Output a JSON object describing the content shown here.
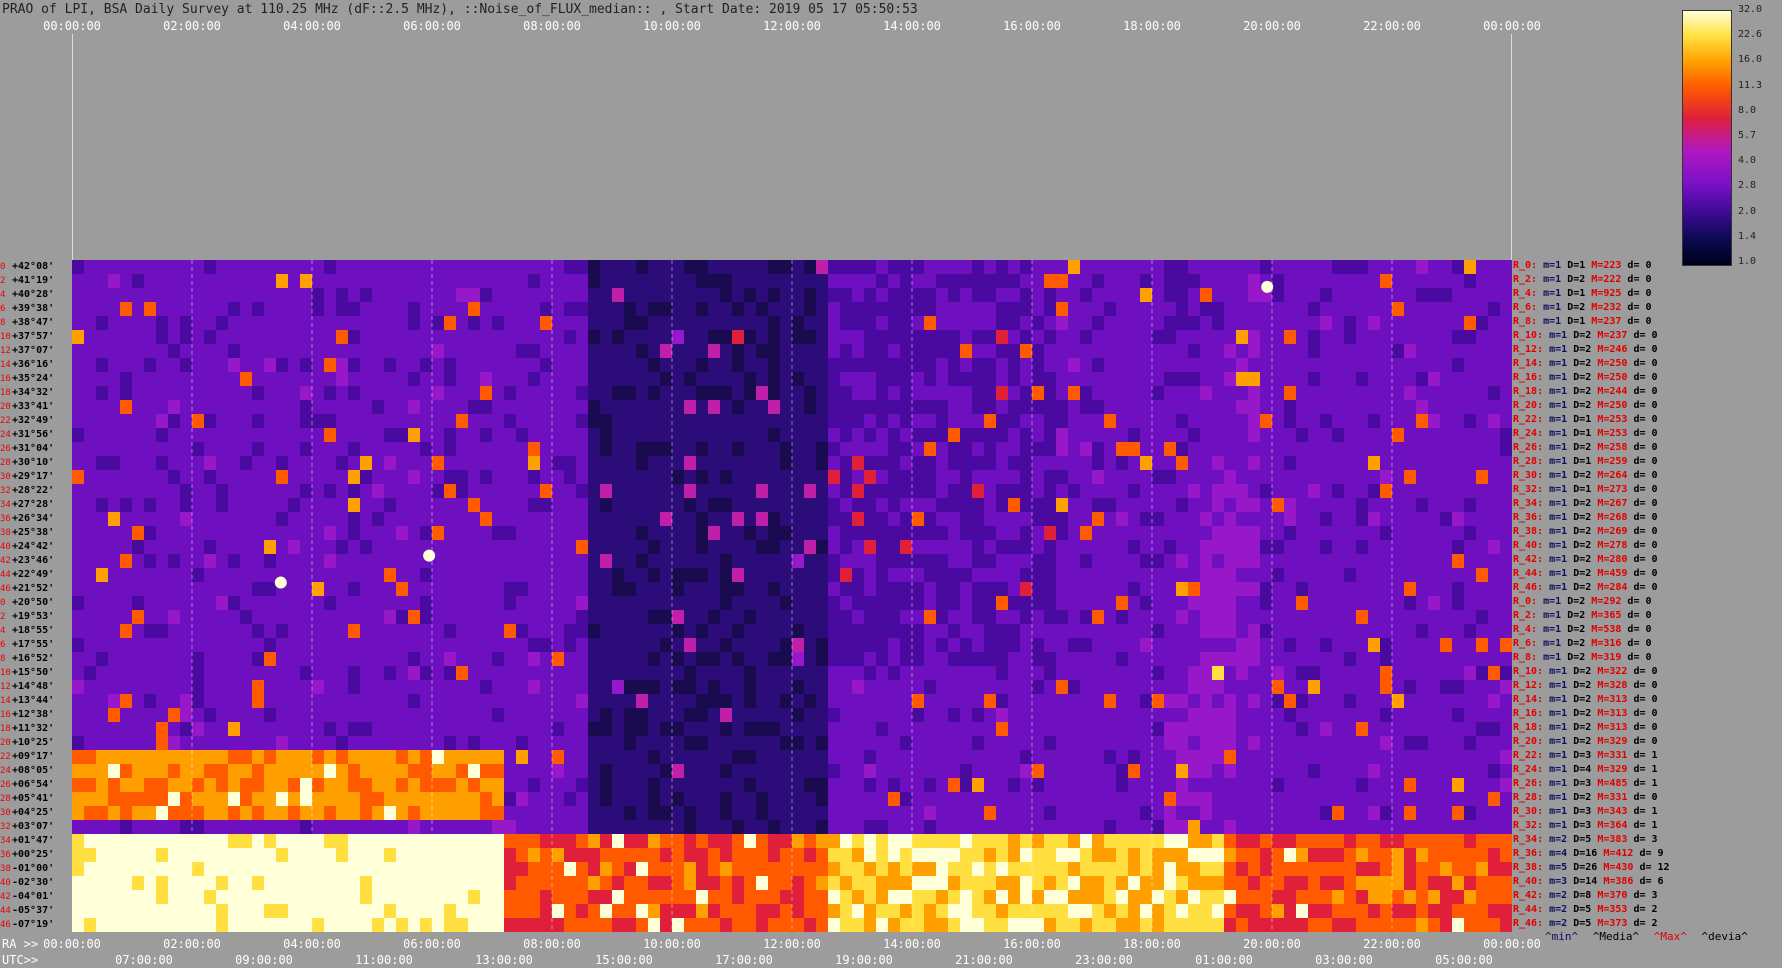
{
  "title": "PRAO of LPI, BSA Daily Survey at 110.25 MHz (dF::2.5 MHz), ::Noise_of_FLUX_median:: , Start Date: 2019 05 17 05:50:53",
  "top_axis": [
    "00:00:00",
    "02:00:00",
    "04:00:00",
    "06:00:00",
    "08:00:00",
    "10:00:00",
    "12:00:00",
    "14:00:00",
    "16:00:00",
    "18:00:00",
    "20:00:00",
    "22:00:00",
    "00:00:00"
  ],
  "ra_label": "RA >>",
  "utc_label": "UTC>>",
  "ra_axis": [
    "00:00:00",
    "02:00:00",
    "04:00:00",
    "06:00:00",
    "08:00:00",
    "10:00:00",
    "12:00:00",
    "14:00:00",
    "16:00:00",
    "18:00:00",
    "20:00:00",
    "22:00:00",
    "00:00:00"
  ],
  "utc_axis": [
    "07:00:00",
    "09:00:00",
    "11:00:00",
    "13:00:00",
    "15:00:00",
    "17:00:00",
    "19:00:00",
    "21:00:00",
    "23:00:00",
    "01:00:00",
    "03:00:00",
    "05:00:00"
  ],
  "colorbar": {
    "ticks": [
      "32.0",
      "22.6",
      "16.0",
      "11.3",
      "8.0",
      "5.7",
      "4.0",
      "2.8",
      "2.0",
      "1.4",
      "1.0"
    ],
    "colors": [
      "#000018",
      "#3a0a90",
      "#b018c0",
      "#e0203a",
      "#ff5a00",
      "#ffa000",
      "#ffe040",
      "#ffffd8"
    ]
  },
  "bottom_legend": {
    "min": "^min^",
    "median": "^Media^",
    "max": "^Max^",
    "dev": "^devia^"
  },
  "chart_data": {
    "type": "heatmap",
    "title": "PRAO of LPI, BSA Daily Survey at 110.25 MHz (dF::2.5 MHz), ::Noise_of_FLUX_median:: , Start Date: 2019 05 17 05:50:53",
    "x_axis_ra": [
      "00:00:00",
      "02:00:00",
      "04:00:00",
      "06:00:00",
      "08:00:00",
      "10:00:00",
      "12:00:00",
      "14:00:00",
      "16:00:00",
      "18:00:00",
      "20:00:00",
      "22:00:00",
      "00:00:00"
    ],
    "x_axis_utc": [
      "07:00:00",
      "09:00:00",
      "11:00:00",
      "13:00:00",
      "15:00:00",
      "17:00:00",
      "19:00:00",
      "21:00:00",
      "23:00:00",
      "01:00:00",
      "03:00:00",
      "05:00:00"
    ],
    "colorbar_range": [
      1.0,
      32.0
    ],
    "rows": [
      {
        "idx": "0",
        "dec": "+42°08'",
        "r": "R_0:",
        "m": "1",
        "D": "1",
        "M": "223",
        "d": "0"
      },
      {
        "idx": "2",
        "dec": "+41°19'",
        "r": "R_2:",
        "m": "1",
        "D": "2",
        "M": "222",
        "d": "0"
      },
      {
        "idx": "4",
        "dec": "+40°28'",
        "r": "R_4:",
        "m": "1",
        "D": "1",
        "M": "925",
        "d": "0"
      },
      {
        "idx": "6",
        "dec": "+39°38'",
        "r": "R_6:",
        "m": "1",
        "D": "2",
        "M": "232",
        "d": "0"
      },
      {
        "idx": "8",
        "dec": "+38°47'",
        "r": "R_8:",
        "m": "1",
        "D": "1",
        "M": "237",
        "d": "0"
      },
      {
        "idx": "10",
        "dec": "+37°57'",
        "r": "R_10:",
        "m": "1",
        "D": "2",
        "M": "237",
        "d": "0"
      },
      {
        "idx": "12",
        "dec": "+37°07'",
        "r": "R_12:",
        "m": "1",
        "D": "2",
        "M": "246",
        "d": "0"
      },
      {
        "idx": "14",
        "dec": "+36°16'",
        "r": "R_14:",
        "m": "1",
        "D": "2",
        "M": "250",
        "d": "0"
      },
      {
        "idx": "16",
        "dec": "+35°24'",
        "r": "R_16:",
        "m": "1",
        "D": "2",
        "M": "250",
        "d": "0"
      },
      {
        "idx": "18",
        "dec": "+34°32'",
        "r": "R_18:",
        "m": "1",
        "D": "2",
        "M": "244",
        "d": "0"
      },
      {
        "idx": "20",
        "dec": "+33°41'",
        "r": "R_20:",
        "m": "1",
        "D": "2",
        "M": "250",
        "d": "0"
      },
      {
        "idx": "22",
        "dec": "+32°49'",
        "r": "R_22:",
        "m": "1",
        "D": "1",
        "M": "253",
        "d": "0"
      },
      {
        "idx": "24",
        "dec": "+31°56'",
        "r": "R_24:",
        "m": "1",
        "D": "1",
        "M": "253",
        "d": "0"
      },
      {
        "idx": "26",
        "dec": "+31°04'",
        "r": "R_26:",
        "m": "1",
        "D": "2",
        "M": "258",
        "d": "0"
      },
      {
        "idx": "28",
        "dec": "+30°10'",
        "r": "R_28:",
        "m": "1",
        "D": "1",
        "M": "259",
        "d": "0"
      },
      {
        "idx": "30",
        "dec": "+29°17'",
        "r": "R_30:",
        "m": "1",
        "D": "2",
        "M": "264",
        "d": "0"
      },
      {
        "idx": "32",
        "dec": "+28°22'",
        "r": "R_32:",
        "m": "1",
        "D": "1",
        "M": "273",
        "d": "0"
      },
      {
        "idx": "34",
        "dec": "+27°28'",
        "r": "R_34:",
        "m": "1",
        "D": "2",
        "M": "267",
        "d": "0"
      },
      {
        "idx": "36",
        "dec": "+26°34'",
        "r": "R_36:",
        "m": "1",
        "D": "2",
        "M": "268",
        "d": "0"
      },
      {
        "idx": "38",
        "dec": "+25°38'",
        "r": "R_38:",
        "m": "1",
        "D": "2",
        "M": "269",
        "d": "0"
      },
      {
        "idx": "40",
        "dec": "+24°42'",
        "r": "R_40:",
        "m": "1",
        "D": "2",
        "M": "278",
        "d": "0"
      },
      {
        "idx": "42",
        "dec": "+23°46'",
        "r": "R_42:",
        "m": "1",
        "D": "2",
        "M": "280",
        "d": "0"
      },
      {
        "idx": "44",
        "dec": "+22°49'",
        "r": "R_44:",
        "m": "1",
        "D": "2",
        "M": "459",
        "d": "0"
      },
      {
        "idx": "46",
        "dec": "+21°52'",
        "r": "R_46:",
        "m": "1",
        "D": "2",
        "M": "284",
        "d": "0"
      },
      {
        "idx": "0",
        "dec": "+20°50'",
        "r": "R_0:",
        "m": "1",
        "D": "2",
        "M": "292",
        "d": "0"
      },
      {
        "idx": "2",
        "dec": "+19°53'",
        "r": "R_2:",
        "m": "1",
        "D": "2",
        "M": "365",
        "d": "0"
      },
      {
        "idx": "4",
        "dec": "+18°55'",
        "r": "R_4:",
        "m": "1",
        "D": "2",
        "M": "538",
        "d": "0"
      },
      {
        "idx": "6",
        "dec": "+17°55'",
        "r": "R_6:",
        "m": "1",
        "D": "2",
        "M": "316",
        "d": "0"
      },
      {
        "idx": "8",
        "dec": "+16°52'",
        "r": "R_8:",
        "m": "1",
        "D": "2",
        "M": "319",
        "d": "0"
      },
      {
        "idx": "10",
        "dec": "+15°50'",
        "r": "R_10:",
        "m": "1",
        "D": "2",
        "M": "322",
        "d": "0"
      },
      {
        "idx": "12",
        "dec": "+14°48'",
        "r": "R_12:",
        "m": "1",
        "D": "2",
        "M": "328",
        "d": "0"
      },
      {
        "idx": "14",
        "dec": "+13°44'",
        "r": "R_14:",
        "m": "1",
        "D": "2",
        "M": "313",
        "d": "0"
      },
      {
        "idx": "16",
        "dec": "+12°38'",
        "r": "R_16:",
        "m": "1",
        "D": "2",
        "M": "313",
        "d": "0"
      },
      {
        "idx": "18",
        "dec": "+11°32'",
        "r": "R_18:",
        "m": "1",
        "D": "2",
        "M": "313",
        "d": "0"
      },
      {
        "idx": "20",
        "dec": "+10°25'",
        "r": "R_20:",
        "m": "1",
        "D": "2",
        "M": "329",
        "d": "0"
      },
      {
        "idx": "22",
        "dec": "+09°17'",
        "r": "R_22:",
        "m": "1",
        "D": "3",
        "M": "331",
        "d": "1"
      },
      {
        "idx": "24",
        "dec": "+08°05'",
        "r": "R_24:",
        "m": "1",
        "D": "4",
        "M": "329",
        "d": "1"
      },
      {
        "idx": "26",
        "dec": "+06°54'",
        "r": "R_26:",
        "m": "1",
        "D": "3",
        "M": "485",
        "d": "1"
      },
      {
        "idx": "28",
        "dec": "+05°41'",
        "r": "R_28:",
        "m": "1",
        "D": "2",
        "M": "331",
        "d": "0"
      },
      {
        "idx": "30",
        "dec": "+04°25'",
        "r": "R_30:",
        "m": "1",
        "D": "3",
        "M": "343",
        "d": "1"
      },
      {
        "idx": "32",
        "dec": "+03°07'",
        "r": "R_32:",
        "m": "1",
        "D": "3",
        "M": "364",
        "d": "1"
      },
      {
        "idx": "34",
        "dec": "+01°47'",
        "r": "R_34:",
        "m": "2",
        "D": "5",
        "M": "383",
        "d": "3"
      },
      {
        "idx": "36",
        "dec": "+00°25'",
        "r": "R_36:",
        "m": "4",
        "D": "16",
        "M": "412",
        "d": "9"
      },
      {
        "idx": "38",
        "dec": "-01°00'",
        "r": "R_38:",
        "m": "5",
        "D": "26",
        "M": "430",
        "d": "12"
      },
      {
        "idx": "40",
        "dec": "-02°30'",
        "r": "R_40:",
        "m": "3",
        "D": "14",
        "M": "386",
        "d": "6"
      },
      {
        "idx": "42",
        "dec": "-04°01'",
        "r": "R_42:",
        "m": "2",
        "D": "8",
        "M": "370",
        "d": "3"
      },
      {
        "idx": "44",
        "dec": "-05°37'",
        "r": "R_44:",
        "m": "2",
        "D": "5",
        "M": "353",
        "d": "2"
      },
      {
        "idx": "46",
        "dec": "-07°19'",
        "r": "R_46:",
        "m": "2",
        "D": "5",
        "M": "373",
        "d": "2"
      }
    ]
  }
}
